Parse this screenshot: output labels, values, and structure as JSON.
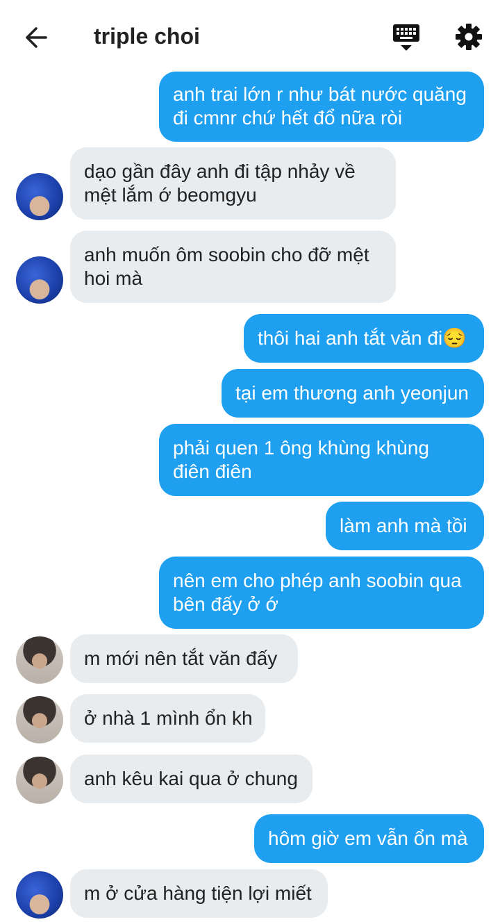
{
  "header": {
    "title": "triple choi",
    "back_icon": "arrow-left-icon",
    "keyboard_icon": "keyboard-icon",
    "settings_icon": "gear-icon"
  },
  "colors": {
    "outgoing_bubble": "#1e9ff0",
    "incoming_bubble": "#e9ecef"
  },
  "messages": [
    {
      "side": "out",
      "lines": [
        "anh trai lớn r như bát nước quăng",
        "đi cmnr chứ hết đổ nữa ròi"
      ]
    },
    {
      "side": "in",
      "avatar": "blue",
      "lines": [
        "dạo gần đây anh đi tập nhảy về",
        "mệt lắm ớ beomgyu"
      ]
    },
    {
      "side": "in",
      "avatar": "blue",
      "lines": [
        "anh muốn ôm soobin cho đỡ mệt",
        "hoi mà"
      ]
    },
    {
      "side": "out",
      "lines": [
        "thôi hai anh tắt văn đi😔"
      ]
    },
    {
      "side": "out",
      "lines": [
        "tại em thương anh yeonjun"
      ]
    },
    {
      "side": "out",
      "lines": [
        "phải quen 1 ông khùng khùng",
        "điên điên"
      ]
    },
    {
      "side": "out",
      "lines": [
        "làm anh mà tồi"
      ]
    },
    {
      "side": "out",
      "lines": [
        "nên em cho phép anh soobin qua",
        "bên đấy ở ớ"
      ]
    },
    {
      "side": "in",
      "avatar": "dark",
      "lines": [
        "m mới nên tắt văn đấy"
      ]
    },
    {
      "side": "in",
      "avatar": "dark",
      "lines": [
        "ở nhà 1 mình ổn kh"
      ]
    },
    {
      "side": "in",
      "avatar": "dark",
      "lines": [
        "anh kêu kai qua ở chung"
      ]
    },
    {
      "side": "out",
      "lines": [
        "hôm giờ em vẫn ổn mà"
      ]
    },
    {
      "side": "in",
      "avatar": "blue",
      "lines": [
        "m ở cửa hàng tiện lợi miết"
      ]
    }
  ]
}
